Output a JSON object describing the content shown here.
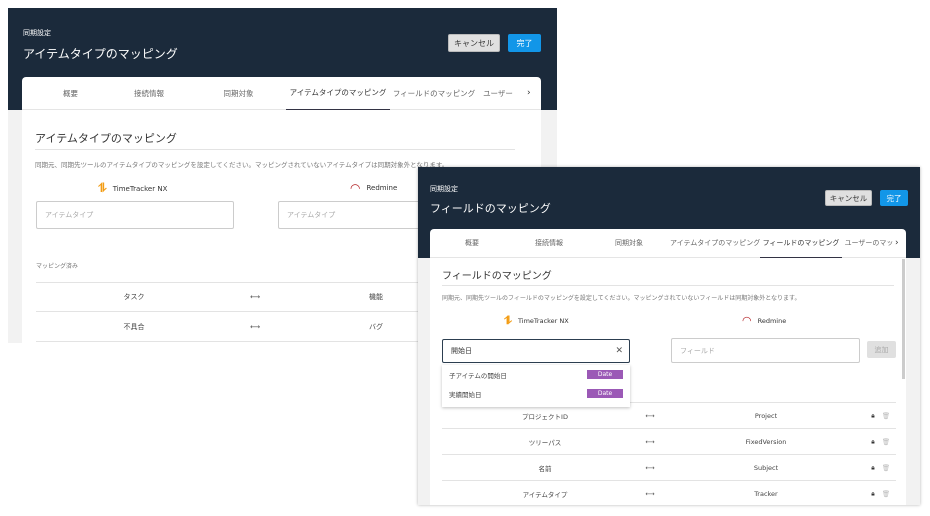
{
  "window1": {
    "breadcrumb": "同期設定",
    "title": "アイテムタイプのマッピング",
    "cancel": "キャンセル",
    "done": "完了",
    "tabs": [
      "概要",
      "接続情報",
      "同期対象",
      "アイテムタイプのマッピング",
      "フィールドのマッピング",
      "ユーザー"
    ],
    "active_tab": 3,
    "section_title": "アイテムタイプのマッピング",
    "description": "同期元、同期先ツールのアイテムタイプのマッピングを設定してください。マッピングされていないアイテムタイプは同期対象外となります。",
    "source_tool": "TimeTracker NX",
    "target_tool": "Redmine",
    "source_placeholder": "アイテムタイプ",
    "target_placeholder": "アイテムタイプ",
    "mapped_label": "マッピング済み",
    "rows": [
      {
        "source": "タスク",
        "target": "機能"
      },
      {
        "source": "不具合",
        "target": "バグ"
      }
    ]
  },
  "window2": {
    "breadcrumb": "同期設定",
    "title": "フィールドのマッピング",
    "cancel": "キャンセル",
    "done": "完了",
    "tabs": [
      "概要",
      "接続情報",
      "同期対象",
      "アイテムタイプのマッピング",
      "フィールドのマッピング",
      "ユーザーのマッ"
    ],
    "active_tab": 4,
    "section_title": "フィールドのマッピング",
    "description": "同期元、同期先ツールのフィールドのマッピングを設定してください。マッピングされていないフィールドは同期対象外となります。",
    "source_tool": "TimeTracker NX",
    "target_tool": "Redmine",
    "source_value": "開始日",
    "target_placeholder": "フィールド",
    "add": "追加",
    "suggestions": [
      {
        "label": "子アイテムの開始日",
        "type": "Date"
      },
      {
        "label": "実績開始日",
        "type": "Date"
      }
    ],
    "rows": [
      {
        "source": "プロジェクトID",
        "target": "Project"
      },
      {
        "source": "ツリーパス",
        "target": "FixedVersion"
      },
      {
        "source": "名前",
        "target": "Subject"
      },
      {
        "source": "アイテムタイプ",
        "target": "Tracker"
      }
    ]
  },
  "colors": {
    "header": "#1b2a3b",
    "primary": "#1296e8",
    "badge": "#9b59b6",
    "arrow": "#555"
  }
}
